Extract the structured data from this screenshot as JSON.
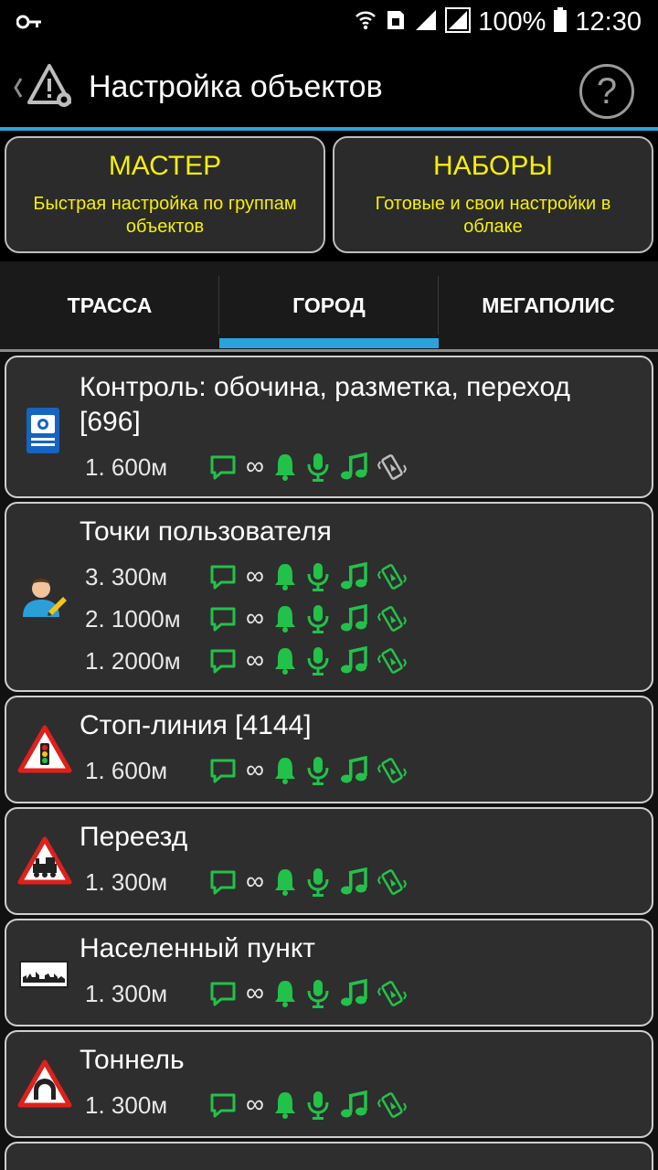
{
  "status_bar": {
    "battery": "100%",
    "time": "12:30"
  },
  "app_bar": {
    "title": "Настройка объектов",
    "help": "?"
  },
  "top_buttons": {
    "master": {
      "title": "МАСТЕР",
      "subtitle": "Быстрая настройка по группам объектов"
    },
    "sets": {
      "title": "НАБОРЫ",
      "subtitle": "Готовые и свои настройки в облаке"
    }
  },
  "tabs": [
    {
      "label": "ТРАССА",
      "selected": false
    },
    {
      "label": "ГОРОД",
      "selected": true
    },
    {
      "label": "МЕГАПОЛИС",
      "selected": false
    }
  ],
  "colors": {
    "accent": "#2aa3dc",
    "yellow": "#f6f000",
    "green": "#22c24a"
  },
  "items": [
    {
      "title": "Контроль: обочина, разметка, переход [696]",
      "icon": "photo-video-control-sign-icon",
      "rows": [
        {
          "dist": "1. 600м",
          "phone_muted": true
        }
      ]
    },
    {
      "title": "Точки пользователя",
      "icon": "user-icon",
      "rows": [
        {
          "dist": "3. 300м",
          "phone_muted": false
        },
        {
          "dist": "2. 1000м",
          "phone_muted": false
        },
        {
          "dist": "1. 2000м",
          "phone_muted": false
        }
      ]
    },
    {
      "title": "Стоп-линия [4144]",
      "icon": "traffic-light-warning-icon",
      "rows": [
        {
          "dist": "1. 600м",
          "phone_muted": false
        }
      ]
    },
    {
      "title": "Переезд",
      "icon": "railway-crossing-icon",
      "rows": [
        {
          "dist": "1. 300м",
          "phone_muted": false
        }
      ]
    },
    {
      "title": "Населенный пункт",
      "icon": "settlement-sign-icon",
      "rows": [
        {
          "dist": "1. 300м",
          "phone_muted": false
        }
      ]
    },
    {
      "title": "Тоннель",
      "icon": "tunnel-warning-icon",
      "rows": [
        {
          "dist": "1. 300м",
          "phone_muted": false
        }
      ]
    }
  ]
}
